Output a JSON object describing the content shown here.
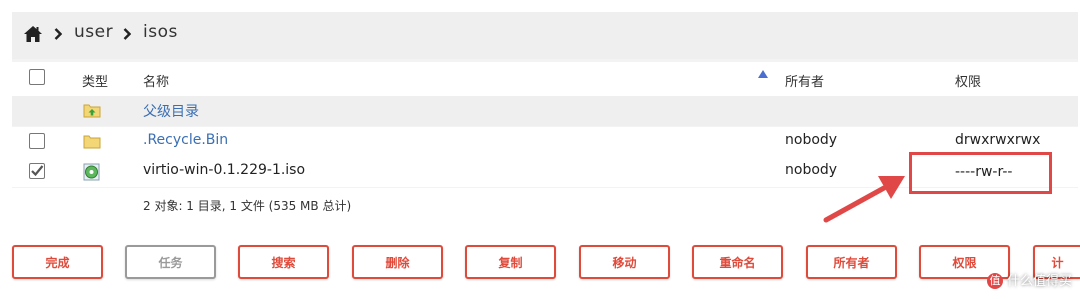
{
  "breadcrumb": {
    "items": [
      "user",
      "isos"
    ]
  },
  "table": {
    "columns": {
      "type": "类型",
      "name": "名称",
      "owner": "所有者",
      "permissions": "权限"
    },
    "rows": [
      {
        "name": "父级目录",
        "owner": "",
        "permissions": "",
        "icon": "folder-up-icon",
        "checked": false
      },
      {
        "name": ".Recycle.Bin",
        "owner": "nobody",
        "permissions": "drwxrwxrwx",
        "icon": "folder-icon",
        "checked": false
      },
      {
        "name": "virtio-win-0.1.229-1.iso",
        "owner": "nobody",
        "permissions": "----rw-r--",
        "icon": "disc-image-icon",
        "checked": true
      }
    ],
    "summary": "2 对象: 1 目录, 1 文件 (535 MB 总计)"
  },
  "actions": [
    {
      "label": "完成",
      "enabled": true
    },
    {
      "label": "任务",
      "enabled": false
    },
    {
      "label": "搜索",
      "enabled": true
    },
    {
      "label": "删除",
      "enabled": true
    },
    {
      "label": "复制",
      "enabled": true
    },
    {
      "label": "移动",
      "enabled": true
    },
    {
      "label": "重命名",
      "enabled": true
    },
    {
      "label": "所有者",
      "enabled": true
    },
    {
      "label": "权限",
      "enabled": true
    },
    {
      "label": "计",
      "enabled": true
    }
  ],
  "watermark": {
    "badge": "值",
    "text": "什么值得买"
  },
  "colors": {
    "accent": "#e04a3a",
    "link": "#3b6fb3",
    "annotation": "#e04848"
  }
}
